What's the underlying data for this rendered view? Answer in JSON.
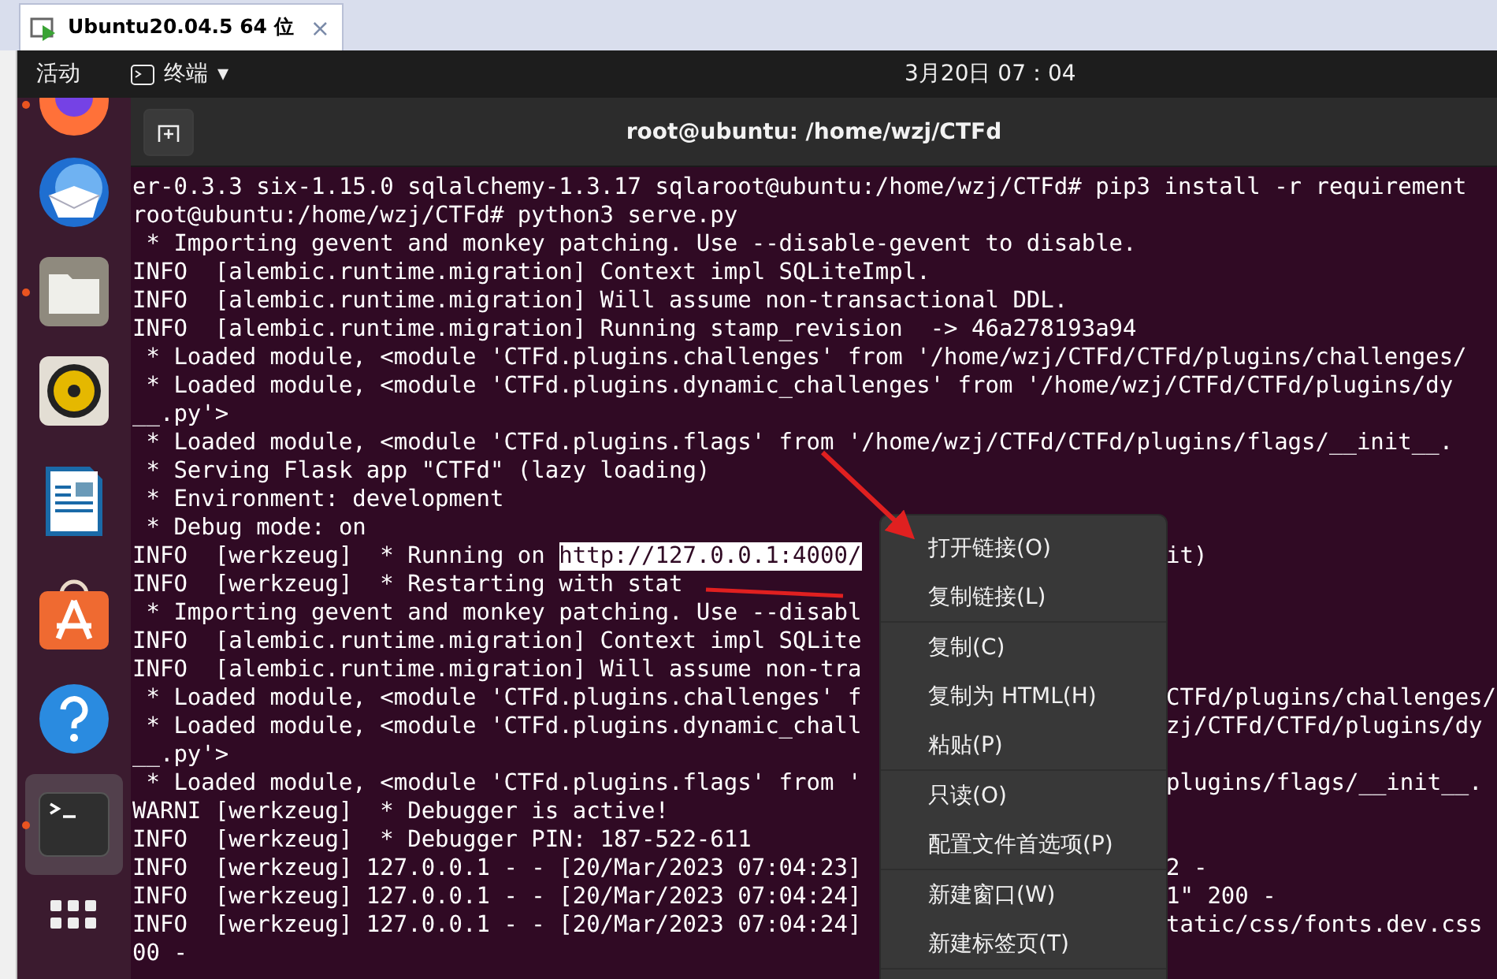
{
  "vm_tab": {
    "title": "Ubuntu20.04.5 64 位",
    "close": "×"
  },
  "top_bar": {
    "activities": "活动",
    "app_menu": "终端",
    "app_caret": "▾",
    "clock": "3月20日 07：04"
  },
  "dock": [
    {
      "kind": "firefox",
      "running": true,
      "active": false
    },
    {
      "kind": "mail",
      "running": false,
      "active": false
    },
    {
      "kind": "files",
      "running": true,
      "active": false
    },
    {
      "kind": "music",
      "running": false,
      "active": false
    },
    {
      "kind": "writer",
      "running": false,
      "active": false
    },
    {
      "kind": "software",
      "running": false,
      "active": false
    },
    {
      "kind": "help",
      "running": false,
      "active": false
    },
    {
      "kind": "terminal",
      "running": true,
      "active": true
    },
    {
      "kind": "apps",
      "running": false,
      "active": false
    }
  ],
  "terminal": {
    "title": "root@ubuntu: /home/wzj/CTFd",
    "lines": [
      {
        "text": "er-0.3.3 six-1.15.0 sqlalchemy-1.3.17 sqlaroot@ubuntu:/home/wzj/CTFd# pip3 install -r requirement"
      },
      {
        "text": "root@ubuntu:/home/wzj/CTFd# python3 serve.py"
      },
      {
        "text": " * Importing gevent and monkey patching. Use --disable-gevent to disable."
      },
      {
        "text": "INFO  [alembic.runtime.migration] Context impl SQLiteImpl."
      },
      {
        "text": "INFO  [alembic.runtime.migration] Will assume non-transactional DDL."
      },
      {
        "text": "INFO  [alembic.runtime.migration] Running stamp_revision  -> 46a278193a94"
      },
      {
        "text": " * Loaded module, <module 'CTFd.plugins.challenges' from '/home/wzj/CTFd/CTFd/plugins/challenges/"
      },
      {
        "text": " * Loaded module, <module 'CTFd.plugins.dynamic_challenges' from '/home/wzj/CTFd/CTFd/plugins/dy"
      },
      {
        "text": "__.py'>"
      },
      {
        "text": " * Loaded module, <module 'CTFd.plugins.flags' from '/home/wzj/CTFd/CTFd/plugins/flags/__init__."
      },
      {
        "text": " * Serving Flask app \"CTFd\" (lazy loading)"
      },
      {
        "text": " * Environment: development"
      },
      {
        "text": " * Debug mode: on"
      },
      {
        "text": "INFO  [werkzeug]  * Running on ",
        "link": "http://127.0.0.1:4000/",
        "right": "it)"
      },
      {
        "text": "INFO  [werkzeug]  * Restarting with stat"
      },
      {
        "text": " * Importing gevent and monkey patching. Use --disabl"
      },
      {
        "text": "INFO  [alembic.runtime.migration] Context impl SQLite"
      },
      {
        "text": "INFO  [alembic.runtime.migration] Will assume non-tra"
      },
      {
        "text": " * Loaded module, <module 'CTFd.plugins.challenges' f",
        "right": "CTFd/plugins/challenges/"
      },
      {
        "text": " * Loaded module, <module 'CTFd.plugins.dynamic_chall",
        "right": "zj/CTFd/CTFd/plugins/dy"
      },
      {
        "text": "__.py'>"
      },
      {
        "text": " * Loaded module, <module 'CTFd.plugins.flags' from '",
        "right": "plugins/flags/__init__."
      },
      {
        "text": "WARNI [werkzeug]  * Debugger is active!"
      },
      {
        "text": "INFO  [werkzeug]  * Debugger PIN: 187-522-611"
      },
      {
        "text": "INFO  [werkzeug] 127.0.0.1 - - [20/Mar/2023 07:04:23]",
        "right": "2 -"
      },
      {
        "text": "INFO  [werkzeug] 127.0.0.1 - - [20/Mar/2023 07:04:24]",
        "right": "1\" 200 -"
      },
      {
        "text": "INFO  [werkzeug] 127.0.0.1 - - [20/Mar/2023 07:04:24]",
        "right": "tatic/css/fonts.dev.css"
      },
      {
        "text": "00 -"
      }
    ]
  },
  "context_menu": {
    "groups": [
      [
        {
          "label": "打开链接(O)"
        },
        {
          "label": "复制链接(L)"
        }
      ],
      [
        {
          "label": "复制(C)"
        },
        {
          "label": "复制为 HTML(H)"
        },
        {
          "label": "粘贴(P)"
        }
      ],
      [
        {
          "label": "只读(O)"
        },
        {
          "label": "配置文件首选项(P)"
        }
      ],
      [
        {
          "label": "新建窗口(W)"
        },
        {
          "label": "新建标签页(T)"
        }
      ]
    ]
  }
}
